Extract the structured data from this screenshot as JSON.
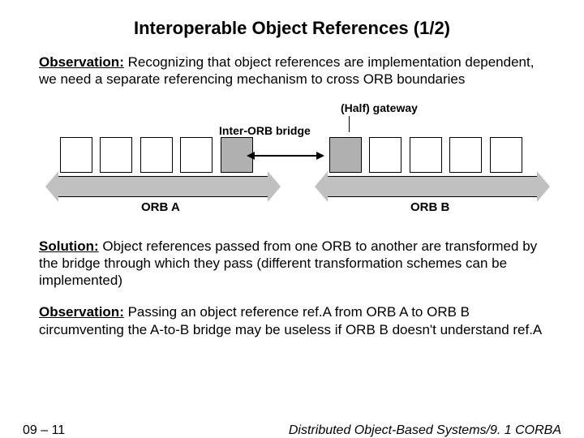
{
  "title": "Interoperable Object References (1/2)",
  "paragraphs": {
    "p1_label": "Observation:",
    "p1_text": " Recognizing that object references are implementation dependent, we need a separate referencing mechanism to cross ORB boundaries",
    "p2_label": "Solution:",
    "p2_text": " Object references passed from one ORB to another are transformed by the bridge through which they pass (different transformation schemes can be implemented)",
    "p3_label": "Observation:",
    "p3_text": " Passing an object reference ref.A from ORB A to ORB B circumventing the A-to-B bridge may be useless if ORB B doesn't understand ref.A"
  },
  "diagram": {
    "half_gateway": "(Half) gateway",
    "inter_orb_bridge": "Inter-ORB bridge",
    "orb_a": "ORB A",
    "orb_b": "ORB B"
  },
  "footer": {
    "page": "09 – 11",
    "source": "Distributed Object-Based Systems/9. 1 CORBA"
  }
}
